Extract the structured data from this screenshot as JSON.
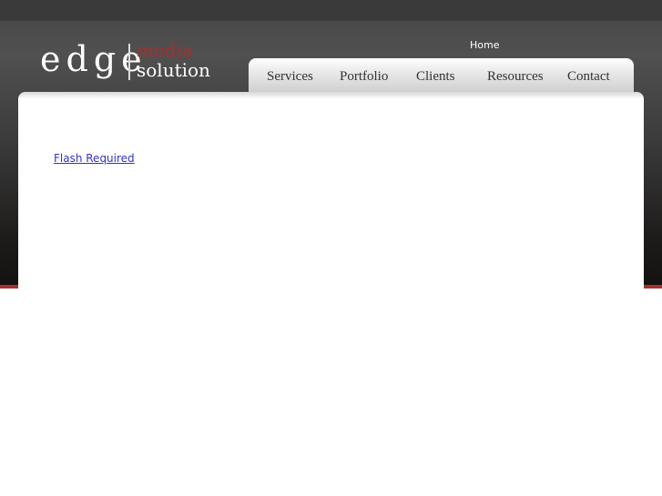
{
  "logo": {
    "word1": "edge",
    "word2": "media",
    "word3": "solution"
  },
  "top_link": "Home",
  "nav": {
    "items": [
      {
        "label": "Services"
      },
      {
        "label": "Portfolio"
      },
      {
        "label": "Clients"
      },
      {
        "label": "Resources"
      },
      {
        "label": "Contact"
      }
    ]
  },
  "content": {
    "flash_link": "Flash Required"
  },
  "colors": {
    "brand_red": "#b02a2a",
    "link_blue": "#3333cc"
  }
}
